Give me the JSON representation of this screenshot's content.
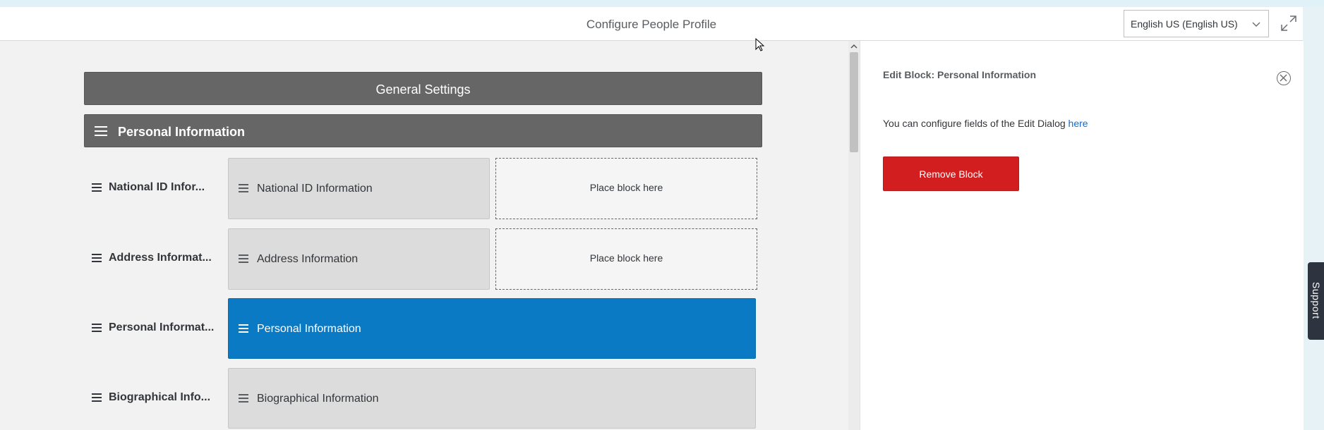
{
  "header": {
    "title": "Configure People Profile",
    "language": "English US (English US)"
  },
  "general_settings_label": "General Settings",
  "section": {
    "label": "Personal Information"
  },
  "rows": [
    {
      "label": "National ID Infor...",
      "block": "National ID Information",
      "placeholder": "Place block here"
    },
    {
      "label": "Address Informat...",
      "block": "Address Information",
      "placeholder": "Place block here"
    },
    {
      "label": "Personal Informat...",
      "block": "Personal Information",
      "selected": true
    },
    {
      "label": "Biographical Info...",
      "block": "Biographical Information"
    }
  ],
  "panel": {
    "title": "Edit Block: Personal Information",
    "text": "You can configure fields of the Edit Dialog",
    "link": "here",
    "remove_label": "Remove Block"
  },
  "support_label": "Support"
}
